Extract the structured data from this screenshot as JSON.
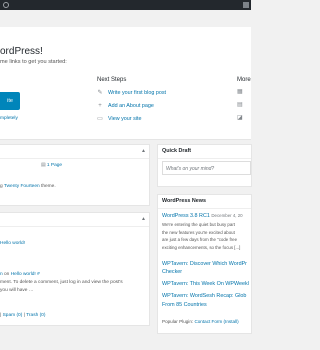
{
  "welcome": {
    "title": "ordPress!",
    "subtitle": "me links to get you started:",
    "cta_label": "ite",
    "dismiss": "mpletely"
  },
  "next_steps": {
    "title": "Next Steps",
    "items": [
      {
        "icon": "edit-icon",
        "label": "Write your first blog post"
      },
      {
        "icon": "plus-icon",
        "label": "Add an About page"
      },
      {
        "icon": "view-icon",
        "label": "View your site"
      }
    ]
  },
  "more_actions": {
    "title": "More"
  },
  "at_a_glance": {
    "toggle": "▲",
    "page_count": "1 Page",
    "theme_prefix": "g",
    "theme_name": "Twenty Fourteen",
    "theme_suffix": "theme."
  },
  "activity": {
    "toggle": "▲",
    "post_link": "Hello world!",
    "commenter": "n",
    "on": "on",
    "comment_post": "Hello world! #",
    "comment_line1": "ment. To delete a comment, just log in and view the post's",
    "comment_line2": "you will have …",
    "spam": "Spam (0)",
    "trash": "Trash (0)",
    "sep": "|"
  },
  "quick_draft": {
    "title": "Quick Draft",
    "placeholder": "What's on your mind?"
  },
  "wordpress_news": {
    "title": "WordPress News",
    "headline": "WordPress 3.8 RC1",
    "date": "December 4, 20",
    "excerpt": [
      "We're entering the quiet but busy part",
      "the new features you're excited about",
      "are just a few days from the \"code free",
      "exciting enhancements, so the focus [...]"
    ],
    "links": [
      "WPTavern: Discover Which WordPr",
      "Checker",
      "WPTavern: This Week On WPWeekl",
      "WPTavern: WordSesh Recap: Glob",
      "From 85 Countries"
    ],
    "popular_label": "Popular Plugin:",
    "popular_plugin": "Contact Form (Install)"
  }
}
